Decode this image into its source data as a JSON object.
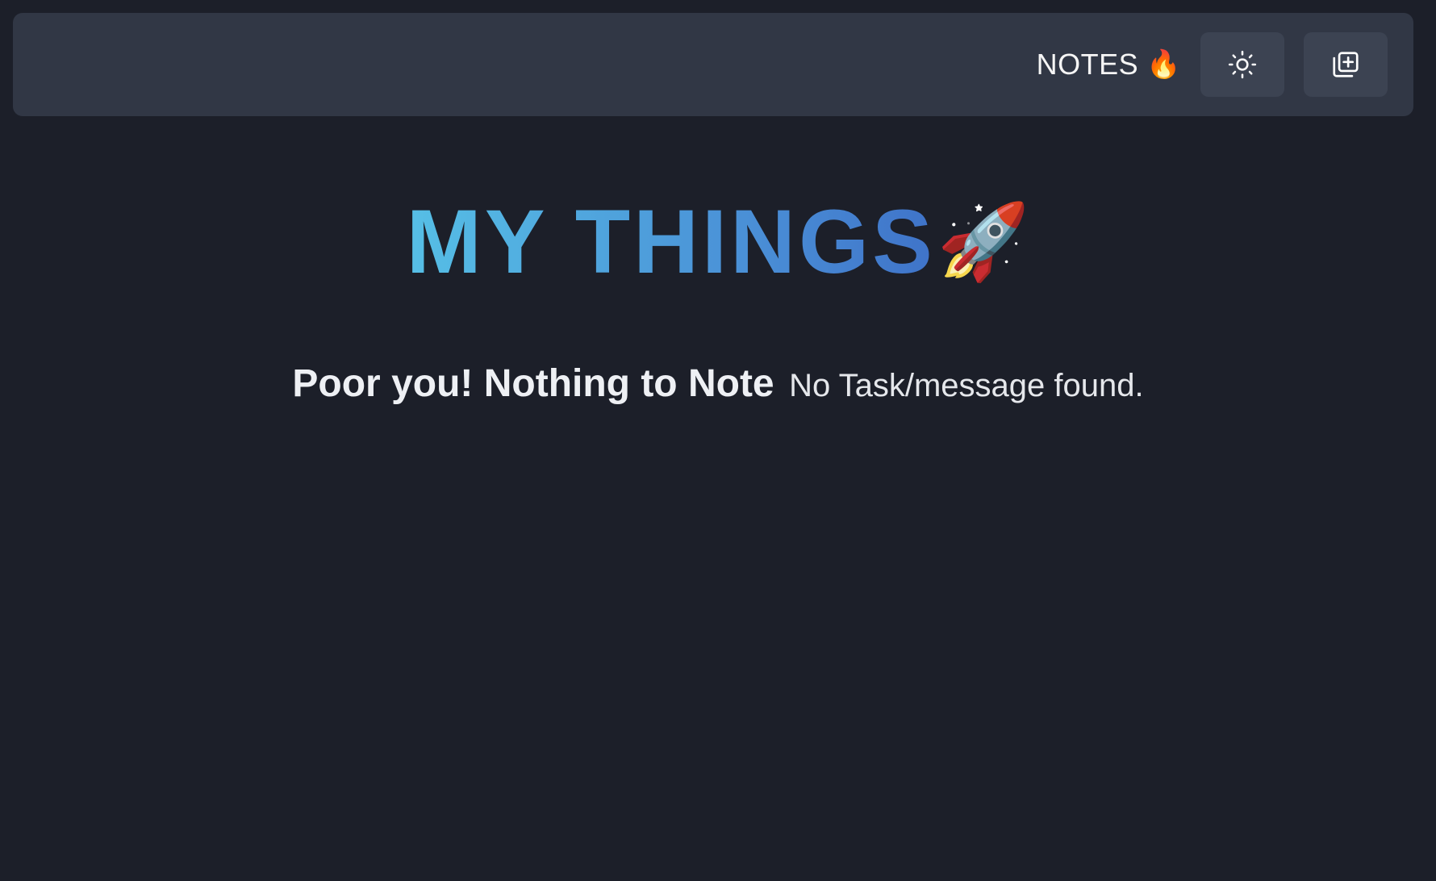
{
  "header": {
    "brand_label": "NOTES",
    "brand_emoji": "🔥",
    "theme_toggle_icon": "sun-icon",
    "add_note_icon": "add-copy-icon"
  },
  "hero": {
    "title": "MY THINGS",
    "emoji": "🚀",
    "gradient_colors": [
      "#56bfe6",
      "#3f73c9"
    ]
  },
  "empty_state": {
    "heading": "Poor you! Nothing to Note",
    "message": "No Task/message found."
  },
  "colors": {
    "background": "#1c1f29",
    "topbar": "#313745",
    "button": "#3c4352"
  }
}
